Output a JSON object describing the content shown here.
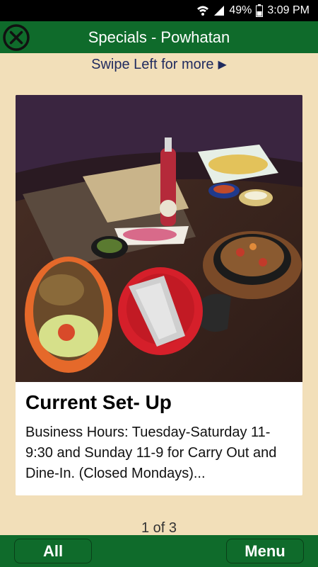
{
  "status_bar": {
    "battery": "49%",
    "time": "3:09 PM"
  },
  "header": {
    "title": "Specials - Powhatan",
    "close_icon": "close-circle-icon"
  },
  "swipe_hint": {
    "text": "Swipe Left for more",
    "arrow": "▶"
  },
  "special": {
    "title": "Current Set- Up",
    "description": "Business Hours: Tuesday-Saturday 11-9:30 and Sunday 11-9 for Carry Out and Dine-In. (Closed Mondays)..."
  },
  "pagination": {
    "text": "1 of 3"
  },
  "bottom_nav": {
    "all_label": "All",
    "menu_label": "Menu"
  },
  "colors": {
    "header_green": "#0f6b2b",
    "background_tan": "#f2dfb9",
    "hint_navy": "#1f2a5e"
  }
}
